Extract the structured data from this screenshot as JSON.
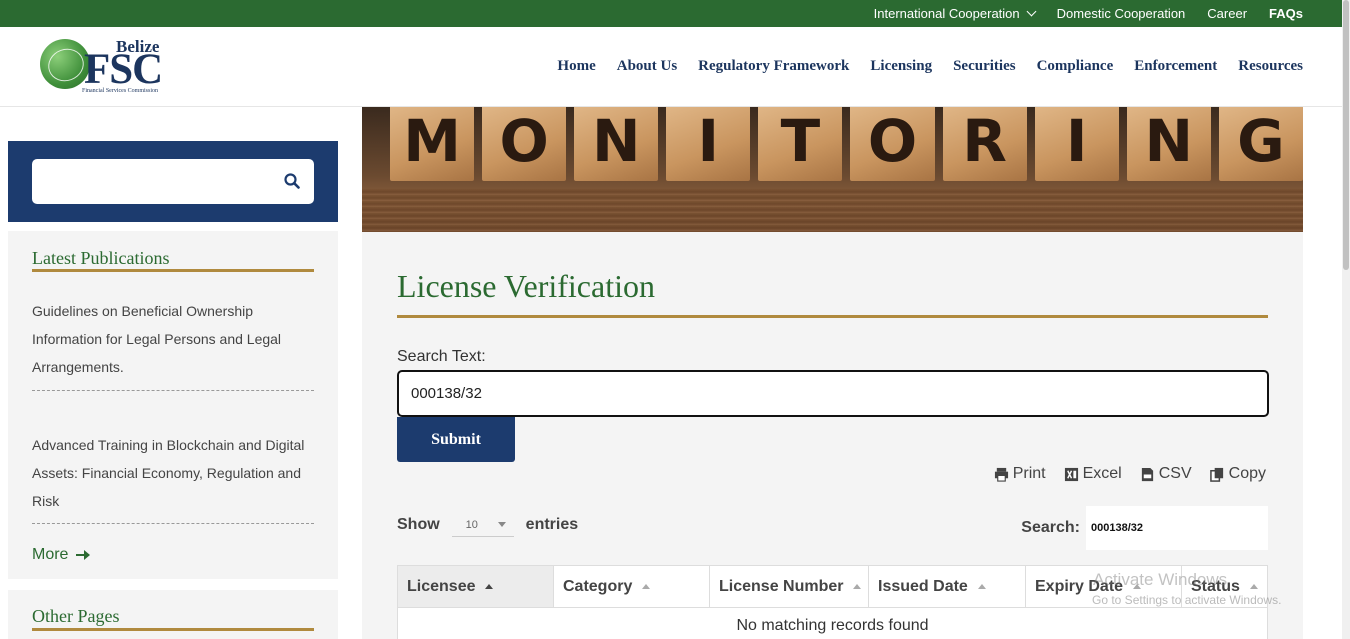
{
  "topbar": {
    "links": [
      "International Cooperation",
      "Domestic Cooperation",
      "Career",
      "FAQs"
    ]
  },
  "logo": {
    "belize": "Belize",
    "fsc": "FSC",
    "tagline": "Financial Services Commission"
  },
  "nav": [
    "Home",
    "About Us",
    "Regulatory Framework",
    "Licensing",
    "Securities",
    "Compliance",
    "Enforcement",
    "Resources"
  ],
  "sidebar": {
    "search_placeholder": "",
    "publications_title": "Latest Publications",
    "publications": [
      "Guidelines on Beneficial Ownership Information for Legal Persons and Legal Arrangements.",
      "Advanced Training in Blockchain and Digital Assets: Financial Economy, Regulation and Risk"
    ],
    "more_label": "More",
    "other_title": "Other Pages"
  },
  "banner": {
    "letters": [
      "M",
      "O",
      "N",
      "I",
      "T",
      "O",
      "R",
      "I",
      "N",
      "G"
    ]
  },
  "main": {
    "title": "License Verification",
    "search_label": "Search Text:",
    "search_value": "000138/32",
    "submit_label": "Submit",
    "exports": [
      "Print",
      "Excel",
      "CSV",
      "Copy"
    ],
    "show_label": "Show",
    "show_value": "10",
    "entries_label": "entries",
    "table_search_label": "Search:",
    "table_search_value": "000138/32",
    "columns": [
      "Licensee",
      "Category",
      "License Number",
      "Issued Date",
      "Expiry Date",
      "Status"
    ],
    "empty_message": "No matching records found"
  },
  "watermark": {
    "line1": "Activate Windows",
    "line2": "Go to Settings to activate Windows."
  },
  "colors": {
    "green": "#2b6a31",
    "navy": "#1c3b6e",
    "gold": "#b08a3e"
  }
}
